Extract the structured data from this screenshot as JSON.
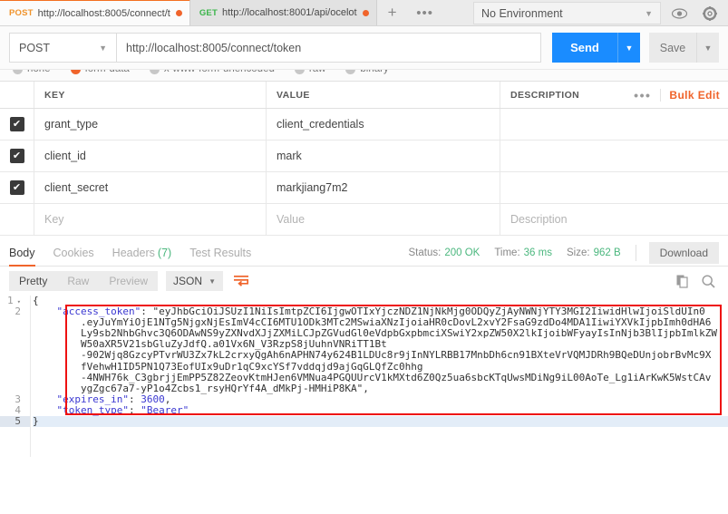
{
  "tabs": [
    {
      "method": "POST",
      "url": "http://localhost:8005/connect/t",
      "unsaved": true,
      "active": true
    },
    {
      "method": "GET",
      "url": "http://localhost:8001/api/ocelot",
      "unsaved": true,
      "active": false
    }
  ],
  "tabbar": {
    "new_tab_label": "+",
    "more_label": "•••",
    "environment": "No Environment",
    "caret": "▼",
    "eye_icon": "eye-icon",
    "gear_icon": "gear-icon"
  },
  "request": {
    "method": "POST",
    "method_caret": "▼",
    "url": "http://localhost:8005/connect/token",
    "send_label": "Send",
    "send_caret": "▼",
    "save_label": "Save",
    "save_caret": "▼"
  },
  "body_types": [
    {
      "label": "none",
      "selected": false
    },
    {
      "label": "form-data",
      "selected": true
    },
    {
      "label": "x-www-form-urlencoded",
      "selected": false
    },
    {
      "label": "raw",
      "selected": false
    },
    {
      "label": "binary",
      "selected": false
    }
  ],
  "params": {
    "headers": {
      "key": "KEY",
      "value": "VALUE",
      "description": "DESCRIPTION"
    },
    "dots_label": "•••",
    "bulk_edit_label": "Bulk Edit",
    "check_glyph": "✔",
    "rows": [
      {
        "checked": true,
        "key": "grant_type",
        "value": "client_credentials",
        "description": ""
      },
      {
        "checked": true,
        "key": "client_id",
        "value": "mark",
        "description": ""
      },
      {
        "checked": true,
        "key": "client_secret",
        "value": "markjiang7m2",
        "description": ""
      }
    ],
    "placeholder_row": {
      "key": "Key",
      "value": "Value",
      "description": "Description"
    }
  },
  "response": {
    "tabs": [
      {
        "label": "Body",
        "count": "",
        "active": true
      },
      {
        "label": "Cookies",
        "count": "",
        "active": false
      },
      {
        "label": "Headers",
        "count": "(7)",
        "active": false
      },
      {
        "label": "Test Results",
        "count": "",
        "active": false
      }
    ],
    "status_label": "Status:",
    "status_value": "200 OK",
    "time_label": "Time:",
    "time_value": "36 ms",
    "size_label": "Size:",
    "size_value": "962 B",
    "download_label": "Download",
    "view_tabs": [
      {
        "label": "Pretty",
        "active": true
      },
      {
        "label": "Raw",
        "active": false
      },
      {
        "label": "Preview",
        "active": false
      }
    ],
    "format": "JSON",
    "format_caret": "▼",
    "wrap_icon": "word-wrap-icon",
    "copy_icon": "copy-icon",
    "search_icon": "search-icon"
  },
  "code": {
    "gutter": [
      "1",
      "2",
      "3",
      "4",
      "5"
    ],
    "lines": [
      {
        "n": 1,
        "text": "{"
      },
      {
        "n": 2,
        "text": "    \"access_token\": \"eyJhbGciOiJSUzI1NiIsImtpZCI6IjgwOTIxYjczNDZ1NjNkMjg0ODQyZjAyNWNjYTY3MGI2IiwidHlwIjoiSldUIn0"
      },
      {
        "n": 2,
        "text": "        .eyJuYmYiOjE1NTg5NjgxNjEsImV4cCI6MTU1ODk3MTc2MSwiaXNzIjoiaHR0cDovL2xvY2FsaG9zdDo4MDA1IiwiYXVkIjpbImh0dHA6"
      },
      {
        "n": 2,
        "text": "        Ly9sb2NhbGhvc3Q6ODAwNS9yZXNvdXJjZXMiLCJpZGVudGl0eVdpbGxpbmciXSwiY2xpZW50X2lkIjoibWFyayIsInNjb3BlIjpbImlkZW"
      },
      {
        "n": 2,
        "text": "        W50aXR5V21sbGluZyJdfQ.a01Vx6N_V3RzpS8jUuhnVNRiTT1Bt"
      },
      {
        "n": 2,
        "text": "        -902Wjq8GzcyPTvrWU3Zx7kL2crxyQgAh6nAPHN74y624B1LDUc8r9jInNYLRBB17MnbDh6cn91BXteVrVQMJDRh9BQeDUnjobrBvMc9X"
      },
      {
        "n": 2,
        "text": "        fVehwH1ID5PN1Q73EofUIx9uDr1qC9xcYSf7vddqjd9ajGqGLQfZc0hhg"
      },
      {
        "n": 2,
        "text": "        -4NWH76k_C3gbrjjEmPP5Z82ZeovKtmHJen6VMNua4PGQUUrcV1kMXtd6Z0Qz5ua6sbcKTqUwsMDiNg9iL00AoTe_Lg1iArKwK5WstCAv"
      },
      {
        "n": 2,
        "text": "        ygZgc67a7-yP1o4Zcbs1_rsyHQrYf4A_dMkPj-HMHiP8KA\","
      },
      {
        "n": 3,
        "text": "    \"expires_in\": 3600,"
      },
      {
        "n": 4,
        "text": "    \"token_type\": \"Bearer\""
      },
      {
        "n": 5,
        "text": "}"
      }
    ],
    "highlight_color": "#ee1111"
  }
}
